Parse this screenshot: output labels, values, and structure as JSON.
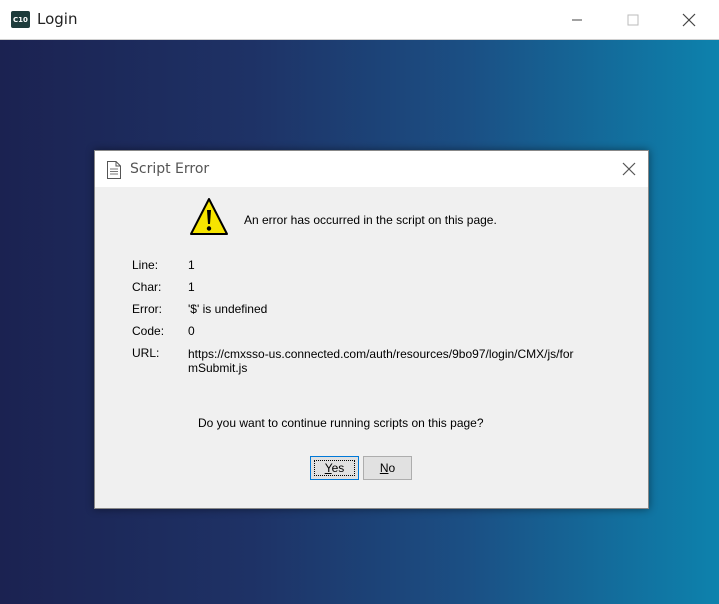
{
  "window": {
    "badge": "C10",
    "title": "Login"
  },
  "dialog": {
    "title": "Script Error",
    "message": "An error has occurred in the script on this page.",
    "fields": [
      {
        "label": "Line:",
        "value": "1"
      },
      {
        "label": "Char:",
        "value": "1"
      },
      {
        "label": "Error:",
        "value": "'$' is undefined"
      },
      {
        "label": "Code:",
        "value": "0"
      },
      {
        "label": "URL:",
        "value": "https://cmxsso-us.connected.com/auth/resources/9bo97/login/CMX/js/formSubmit.js"
      }
    ],
    "question": "Do you want to continue running scripts on this page?",
    "yes_label": "Yes",
    "no_label": "No"
  },
  "colors": {
    "background_left": "#1b2251",
    "background_right": "#0d82ad",
    "dialog_bg": "#f0f0f0"
  }
}
